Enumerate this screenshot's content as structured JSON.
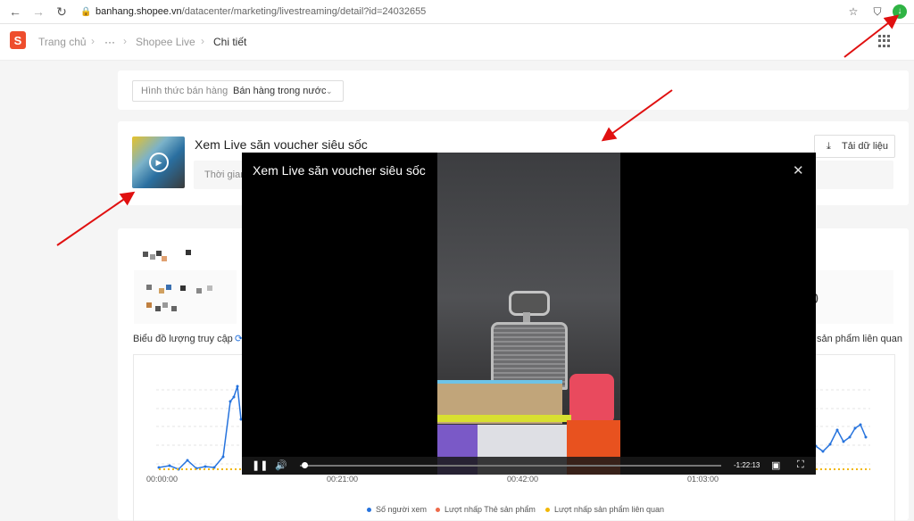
{
  "browser": {
    "url_host": "banhang.shopee.vn",
    "url_path": "/datacenter/marketing/livestreaming/detail?id=24032655"
  },
  "header": {
    "logo_letter": "S",
    "breadcrumb": {
      "home": "Trang chủ",
      "more": "···",
      "section": "Shopee Live",
      "current": "Chi tiết"
    }
  },
  "filter": {
    "label": "Hình thức bán hàng",
    "value": "Bán hàng trong nước"
  },
  "live": {
    "title": "Xem Live săn voucher siêu sốc",
    "export_label": "Tải dữ liệu",
    "time_label": "Thời gian"
  },
  "chart_section": {
    "title": "Biểu đồ lượng truy cập",
    "related_fragment": "sản phẩm liên quan",
    "value_fragment": "0"
  },
  "chart_data": {
    "type": "line",
    "x": [
      "00:00:00",
      "00:21:00",
      "00:42:00",
      "01:03:00"
    ],
    "series": [
      {
        "name": "Số người xem",
        "color": "#2673dd"
      },
      {
        "name": "Lượt nhấp Thẻ sản phẩm",
        "color": "#ee6a4a"
      },
      {
        "name": "Lượt nhấp sản phẩm liên quan",
        "color": "#f2b705"
      }
    ]
  },
  "video": {
    "title": "Xem Live săn voucher siêu sốc",
    "time_remaining": "-1:22:13",
    "progress": 0.01
  }
}
